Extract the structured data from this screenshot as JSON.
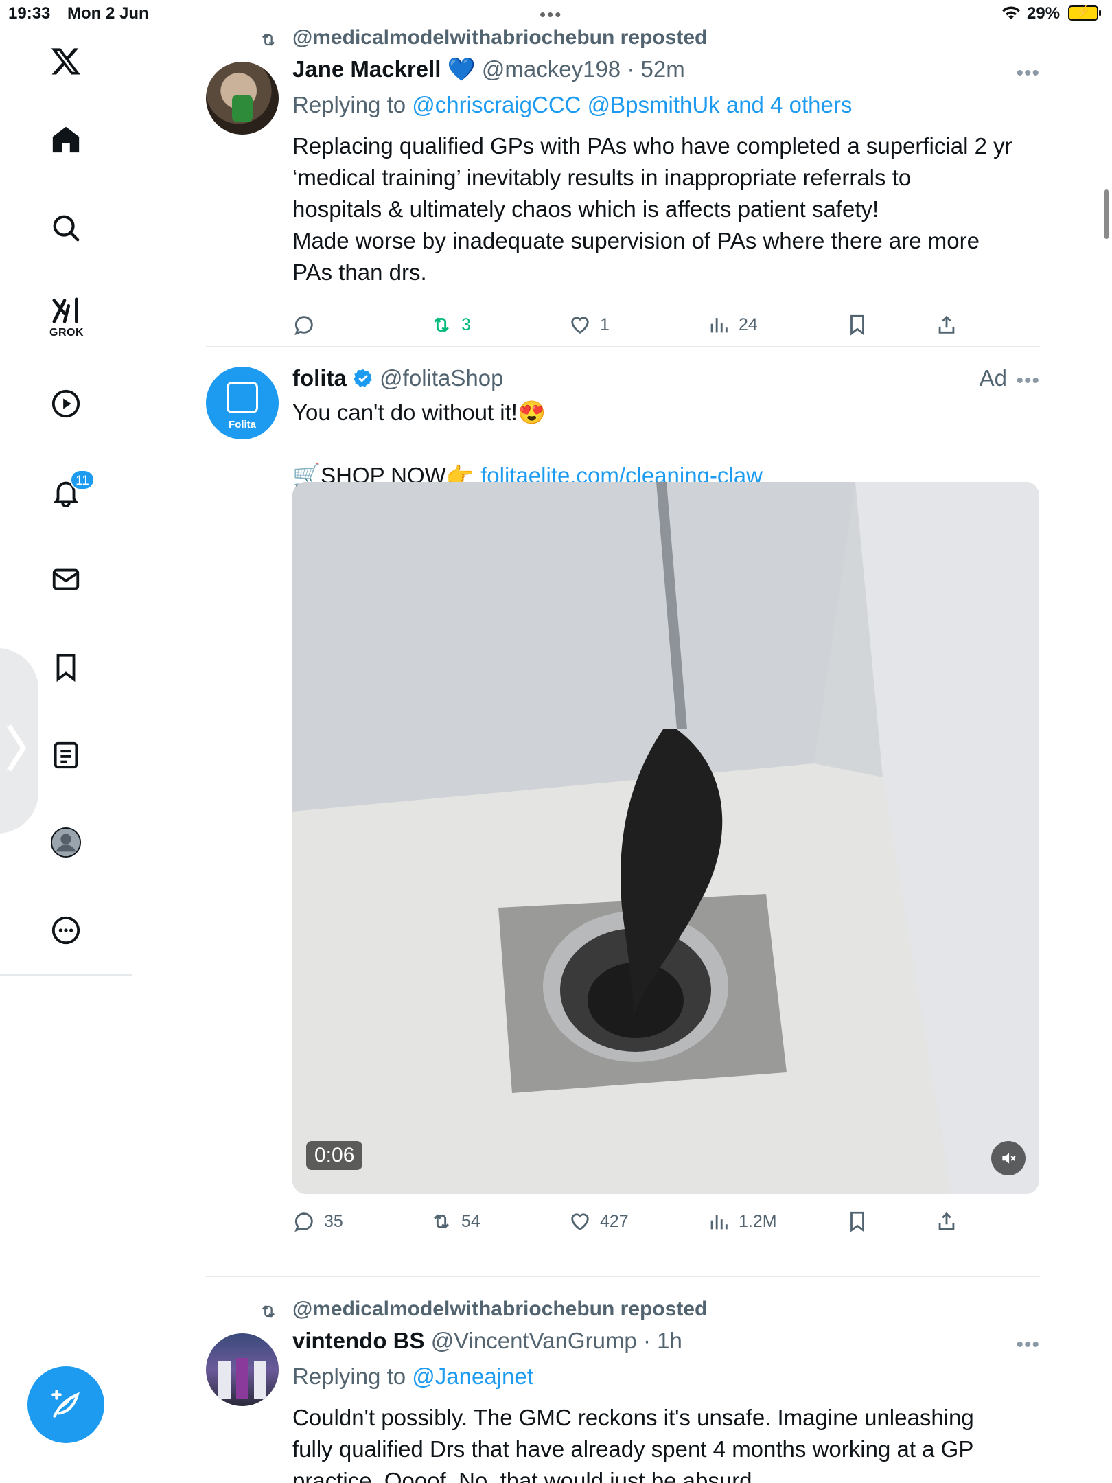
{
  "status_bar": {
    "time": "19:33",
    "date": "Mon 2 Jun",
    "battery": "29%"
  },
  "sidebar": {
    "grok_label": "GROK",
    "notifications_count": "11"
  },
  "posts": [
    {
      "repost_by": "@medicalmodelwithabriochebun reposted",
      "name": "Jane Mackrell",
      "name_emoji": "💙",
      "handle": "@mackey198",
      "time": "· 52m",
      "replying_prefix": "Replying to",
      "replying_to": "@chriscraigCCC @BpsmithUk and 4 others",
      "text_lines": [
        "Replacing qualified GPs with PAs who have completed a superficial 2 yr",
        "‘medical training’ inevitably results in inappropriate referrals to",
        "hospitals & ultimately chaos which is affects patient safety!",
        "Made worse by inadequate supervision of PAs where there are more",
        "PAs than drs."
      ],
      "reposts": "3",
      "likes": "1",
      "views": "24"
    },
    {
      "name": "folita",
      "handle": "@folitaShop",
      "ad_label": "Ad",
      "avatar_label": "Folita",
      "text": "You can't do without it!😍",
      "shop_prefix": "🛒SHOP NOW👉",
      "link": "folitaelite.com/cleaning-claw",
      "video_duration": "0:06",
      "replies": "35",
      "reposts": "54",
      "likes": "427",
      "views": "1.2M"
    },
    {
      "repost_by": "@medicalmodelwithabriochebun reposted",
      "name": "vintendo BS",
      "handle": "@VincentVanGrump",
      "time": "· 1h",
      "replying_prefix": "Replying to",
      "replying_to": "@Janeajnet",
      "text_lines": [
        "Couldn't possibly. The GMC reckons it's unsafe. Imagine unleashing",
        "fully qualified Drs that have already spent 4 months working at a GP",
        "practice. Oooof. No, that would just be absurd."
      ]
    }
  ],
  "colors": {
    "accent": "#1d9bf0",
    "repost_green": "#00ba7c",
    "muted": "#536471"
  }
}
